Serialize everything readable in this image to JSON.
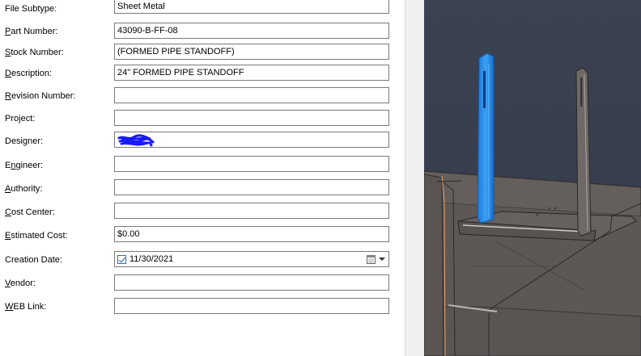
{
  "fields": [
    {
      "id": "file-subtype",
      "label_pre": "File Subtype:",
      "label_u": "",
      "label_post": "",
      "value": "Sheet Metal"
    },
    {
      "id": "part-number",
      "label_pre": "",
      "label_u": "P",
      "label_post": "art Number:",
      "value": "43090-B-FF-08"
    },
    {
      "id": "stock-number",
      "label_pre": "",
      "label_u": "S",
      "label_post": "tock Number:",
      "value": "(FORMED PIPE STANDOFF)"
    },
    {
      "id": "description",
      "label_pre": "",
      "label_u": "D",
      "label_post": "escription:",
      "value": "24\" FORMED PIPE STANDOFF"
    },
    {
      "id": "revision-number",
      "label_pre": "",
      "label_u": "R",
      "label_post": "evision Number:",
      "value": ""
    },
    {
      "id": "project",
      "label_pre": "Pro",
      "label_u": "j",
      "label_post": "ect:",
      "value": ""
    },
    {
      "id": "designer",
      "label_pre": "Desi",
      "label_u": "g",
      "label_post": "ner:",
      "value": ""
    },
    {
      "id": "engineer",
      "label_pre": "E",
      "label_u": "n",
      "label_post": "gineer:",
      "value": ""
    },
    {
      "id": "authority",
      "label_pre": "",
      "label_u": "A",
      "label_post": "uthority:",
      "value": ""
    },
    {
      "id": "cost-center",
      "label_pre": "",
      "label_u": "C",
      "label_post": "ost Center:",
      "value": ""
    },
    {
      "id": "estimated-cost",
      "label_pre": "",
      "label_u": "E",
      "label_post": "stimated Cost:",
      "value": "$0.00"
    },
    {
      "id": "creation-date",
      "label_pre": "Creation Date:",
      "label_u": "",
      "label_post": "",
      "value": "11/30/2021"
    },
    {
      "id": "vendor",
      "label_pre": "",
      "label_u": "V",
      "label_post": "endor:",
      "value": ""
    },
    {
      "id": "web-link",
      "label_pre": "",
      "label_u": "W",
      "label_post": "EB Link:",
      "value": ""
    }
  ],
  "colors": {
    "viewport_bg": "#3a4150",
    "model_gray": "#6b6563",
    "selected_blue": "#2f8fe8",
    "redaction_blue": "#1a1aff",
    "edge_orange": "#e0a070"
  },
  "icons": [
    "checkbox-checked-icon",
    "calendar-icon",
    "dropdown-arrow-icon"
  ]
}
